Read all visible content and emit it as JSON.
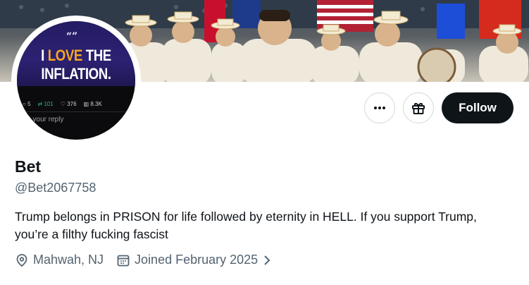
{
  "avatar": {
    "quote": "“”",
    "line1_prefix": "I ",
    "line1_highlight": "LOVE",
    "line1_suffix": " THE",
    "line2": "INFLATION.",
    "stats": [
      "5",
      "101",
      "376",
      "8.3K"
    ],
    "reply_placeholder": "st your reply"
  },
  "actions": {
    "more_icon": "more-dots-icon",
    "gift_icon": "gift-icon",
    "follow_label": "Follow"
  },
  "profile": {
    "name": "Bet",
    "handle": "@Bet2067758",
    "bio": "Trump belongs in PRISON for life followed by eternity in HELL. If you support Trump, you’re a filthy fucking fascist",
    "location": "Mahwah, NJ",
    "joined": "Joined February 2025"
  },
  "colors": {
    "follow_bg": "#0f1419",
    "muted_text": "#536471",
    "avatar_bg": "#241c64",
    "avatar_highlight": "#f5a623"
  }
}
